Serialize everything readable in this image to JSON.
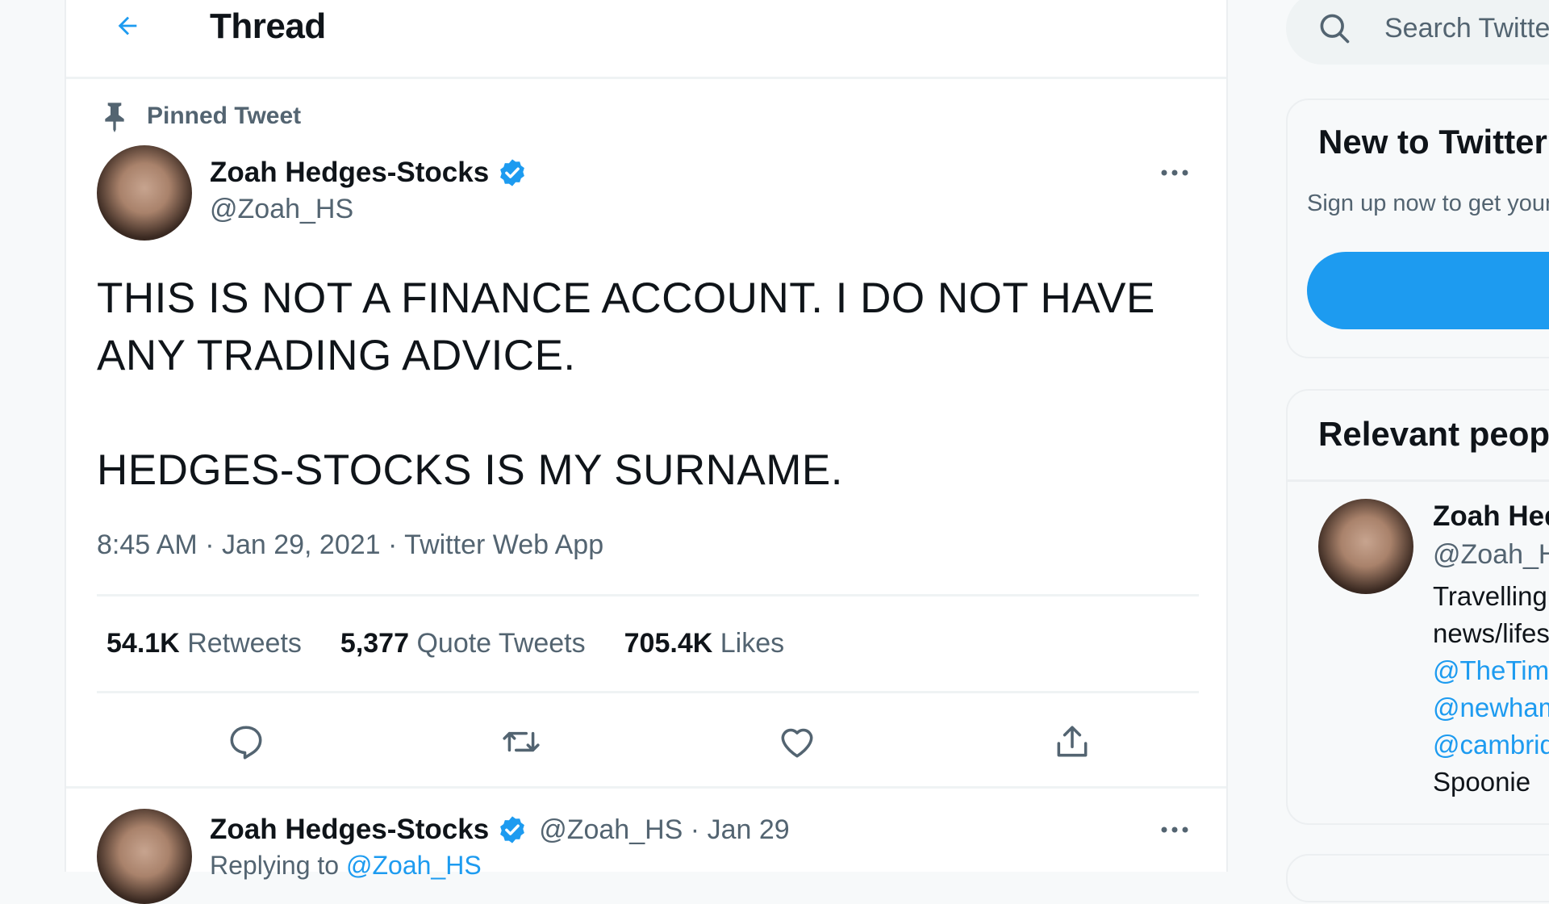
{
  "header": {
    "title": "Thread"
  },
  "tweet": {
    "pinned_label": "Pinned Tweet",
    "author_name": "Zoah Hedges-Stocks",
    "author_handle": "@Zoah_HS",
    "text_line1": "THIS IS NOT A FINANCE ACCOUNT. I DO NOT HAVE ANY TRADING ADVICE.",
    "text_line2": "HEDGES-STOCKS IS MY SURNAME.",
    "meta": "8:45 AM · Jan 29, 2021 · Twitter Web App",
    "stats": {
      "retweets_count": "54.1K",
      "retweets_label": "Retweets",
      "quotes_count": "5,377",
      "quotes_label": "Quote Tweets",
      "likes_count": "705.4K",
      "likes_label": "Likes"
    }
  },
  "reply": {
    "author_name": "Zoah Hedges-Stocks",
    "handle_date": "@Zoah_HS · Jan 29",
    "replying_prefix": "Replying to",
    "replying_handle": "@Zoah_HS"
  },
  "sidebar": {
    "search_placeholder": "Search Twitter",
    "new_card": {
      "title": "New to Twitter?",
      "subtitle": "Sign up now to get your own personalized timeline!"
    },
    "relevant_card": {
      "title": "Relevant people",
      "person_name": "Zoah Hedges-Stocks",
      "person_handle": "@Zoah_HS",
      "bio_line1": "Travelling",
      "bio_line2": "news/lifestyle",
      "bio_link1": "@TheTimes",
      "bio_link2": "@newhamrecorder",
      "bio_link3": "@cambridgenews",
      "bio_line3": "Spoonie"
    }
  },
  "colors": {
    "accent": "#1d9bf0",
    "secondary_text": "#536471",
    "primary_text": "#0f1419"
  },
  "icons": [
    "back-arrow-icon",
    "pin-icon",
    "verified-badge-icon",
    "more-icon",
    "reply-icon",
    "retweet-icon",
    "like-icon",
    "share-icon",
    "search-icon"
  ]
}
